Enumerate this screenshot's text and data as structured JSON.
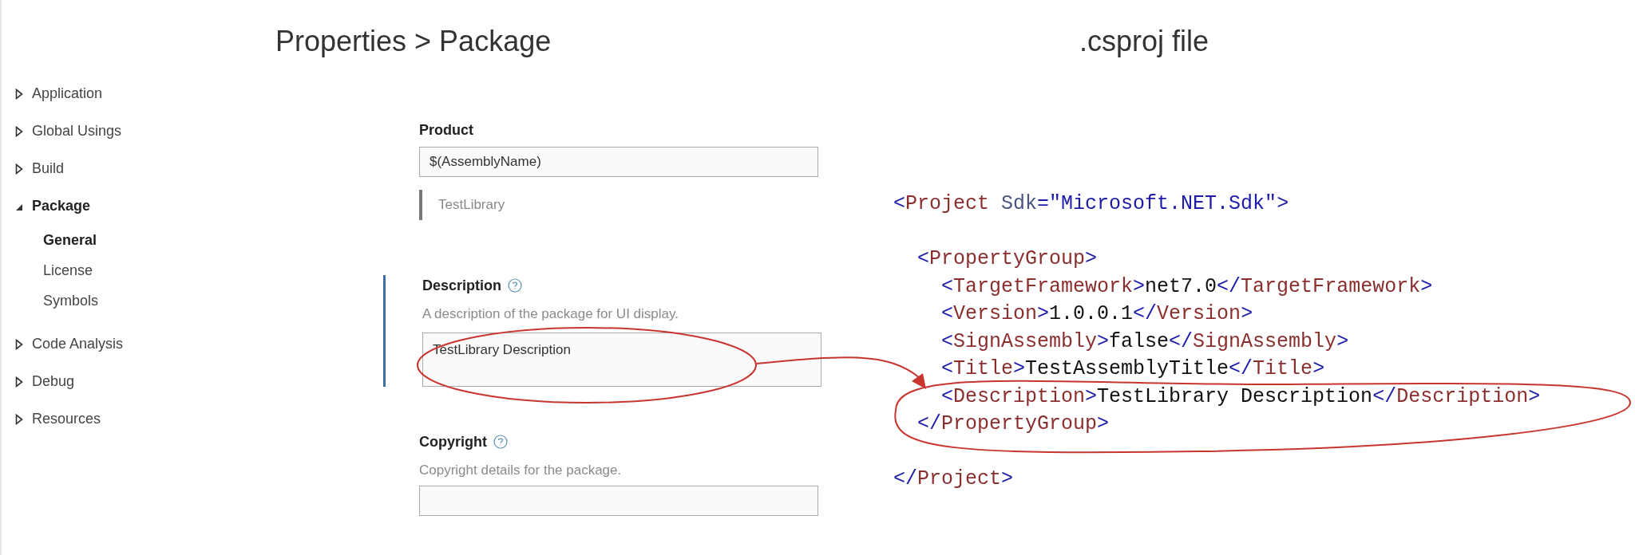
{
  "headings": [
    {
      "text": "Properties > Package"
    },
    {
      "text": ".csproj file"
    }
  ],
  "sidebar": {
    "items": [
      {
        "label": "Application",
        "expanded": false
      },
      {
        "label": "Global Usings",
        "expanded": false
      },
      {
        "label": "Build",
        "expanded": false
      },
      {
        "label": "Package",
        "expanded": true,
        "children": [
          {
            "label": "General",
            "selected": true
          },
          {
            "label": "License",
            "selected": false
          },
          {
            "label": "Symbols",
            "selected": false
          }
        ]
      },
      {
        "label": "Code Analysis",
        "expanded": false
      },
      {
        "label": "Debug",
        "expanded": false
      },
      {
        "label": "Resources",
        "expanded": false
      }
    ]
  },
  "form": {
    "fields": [
      {
        "label": "Product",
        "help_icon": false,
        "focused": false,
        "value": "$(AssemblyName)",
        "evaluated": "TestLibrary",
        "kind": "input"
      },
      {
        "label": "Description",
        "help_icon": true,
        "focused": true,
        "hint": "A description of the package for UI display.",
        "value": "TestLibrary Description",
        "kind": "textarea"
      },
      {
        "label": "Copyright",
        "help_icon": true,
        "focused": false,
        "hint": "Copyright details for the package.",
        "kind": "input"
      }
    ]
  },
  "code": {
    "lines": [
      {
        "gap_before": false,
        "tokens": [
          {
            "kind": "punct",
            "text": "<"
          },
          {
            "kind": "tag",
            "text": "Project"
          },
          {
            "kind": "attr",
            "text": " Sdk"
          },
          {
            "kind": "punct",
            "text": "="
          },
          {
            "kind": "value",
            "text": "\"Microsoft.NET.Sdk\""
          },
          {
            "kind": "punct",
            "text": ">"
          }
        ]
      },
      {
        "gap_before": true,
        "tokens": [
          {
            "kind": "punct",
            "text": "  <"
          },
          {
            "kind": "tag",
            "text": "PropertyGroup"
          },
          {
            "kind": "punct",
            "text": ">"
          }
        ]
      },
      {
        "gap_before": false,
        "tokens": [
          {
            "kind": "punct",
            "text": "    <"
          },
          {
            "kind": "tag",
            "text": "TargetFramework"
          },
          {
            "kind": "punct",
            "text": ">"
          },
          {
            "kind": "text",
            "text": "net7.0"
          },
          {
            "kind": "punct",
            "text": "</"
          },
          {
            "kind": "tag",
            "text": "TargetFramework"
          },
          {
            "kind": "punct",
            "text": ">"
          }
        ]
      },
      {
        "gap_before": false,
        "tokens": [
          {
            "kind": "punct",
            "text": "    <"
          },
          {
            "kind": "tag",
            "text": "Version"
          },
          {
            "kind": "punct",
            "text": ">"
          },
          {
            "kind": "text",
            "text": "1.0.0.1"
          },
          {
            "kind": "punct",
            "text": "</"
          },
          {
            "kind": "tag",
            "text": "Version"
          },
          {
            "kind": "punct",
            "text": ">"
          }
        ]
      },
      {
        "gap_before": false,
        "tokens": [
          {
            "kind": "punct",
            "text": "    <"
          },
          {
            "kind": "tag",
            "text": "SignAssembly"
          },
          {
            "kind": "punct",
            "text": ">"
          },
          {
            "kind": "text",
            "text": "false"
          },
          {
            "kind": "punct",
            "text": "</"
          },
          {
            "kind": "tag",
            "text": "SignAssembly"
          },
          {
            "kind": "punct",
            "text": ">"
          }
        ]
      },
      {
        "gap_before": false,
        "tokens": [
          {
            "kind": "punct",
            "text": "    <"
          },
          {
            "kind": "tag",
            "text": "Title"
          },
          {
            "kind": "punct",
            "text": ">"
          },
          {
            "kind": "text",
            "text": "TestAssemblyTitle"
          },
          {
            "kind": "punct",
            "text": "</"
          },
          {
            "kind": "tag",
            "text": "Title"
          },
          {
            "kind": "punct",
            "text": ">"
          }
        ]
      },
      {
        "gap_before": false,
        "tokens": [
          {
            "kind": "punct",
            "text": "    <"
          },
          {
            "kind": "tag",
            "text": "Description"
          },
          {
            "kind": "punct",
            "text": ">"
          },
          {
            "kind": "text",
            "text": "TestLibrary Description"
          },
          {
            "kind": "punct",
            "text": "</"
          },
          {
            "kind": "tag",
            "text": "Description"
          },
          {
            "kind": "punct",
            "text": ">"
          }
        ]
      },
      {
        "gap_before": false,
        "tokens": [
          {
            "kind": "punct",
            "text": "  </"
          },
          {
            "kind": "tag",
            "text": "PropertyGroup"
          },
          {
            "kind": "punct",
            "text": ">"
          }
        ]
      },
      {
        "gap_before": true,
        "tokens": [
          {
            "kind": "punct",
            "text": "</"
          },
          {
            "kind": "tag",
            "text": "Project"
          },
          {
            "kind": "punct",
            "text": ">"
          }
        ]
      }
    ]
  }
}
